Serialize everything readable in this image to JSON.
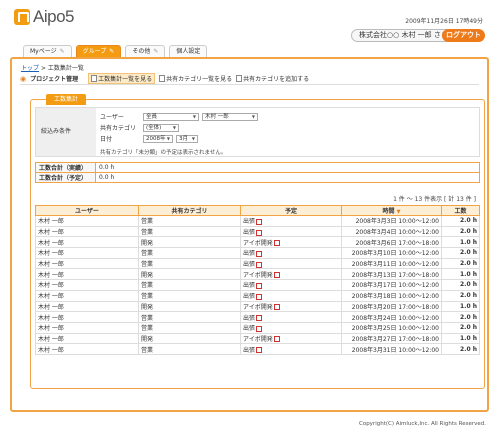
{
  "app": {
    "name": "Aipo5"
  },
  "header": {
    "datetime": "2009年11月26日 17時49分",
    "user": "株式会社○○ 木村 一郎 さま",
    "logout": "ログアウト"
  },
  "tabs": [
    "Myページ",
    "グループ",
    "その他",
    "個人設定"
  ],
  "breadcrumb": {
    "top": "トップ",
    "sep": " > ",
    "current": "工数集計一覧"
  },
  "subnav": {
    "title": "プロジェクト管理",
    "links": [
      "工数集計一覧を見る",
      "共有カテゴリ一覧を見る",
      "共有カテゴリを追加する"
    ]
  },
  "panel_tab": "工数集計",
  "filter": {
    "label": "絞込み条件",
    "user_label": "ユーザー",
    "group_value": "全員",
    "user_value": "木村 一郎",
    "category_label": "共有カテゴリ",
    "category_value": "(全体)",
    "date_label": "日付",
    "year_value": "2008年",
    "month_value": "3月",
    "note": "共有カテゴリ「未分類」の予定は表示されません。"
  },
  "summary": [
    {
      "label": "工数合計（実績）",
      "value": "0.0 h"
    },
    {
      "label": "工数合計（予定）",
      "value": "0.0 h"
    }
  ],
  "count": "1 件 〜 13 件表示 [ 計 13 件 ]",
  "columns": [
    "ユーザー",
    "共有カテゴリ",
    "予定",
    "時間",
    "工数"
  ],
  "rows": [
    [
      "木村 一郎",
      "営業",
      "出張",
      "2008年3月3日 10:00〜12:00",
      "2.0 h"
    ],
    [
      "木村 一郎",
      "営業",
      "出張",
      "2008年3月4日 10:00〜12:00",
      "2.0 h"
    ],
    [
      "木村 一郎",
      "開発",
      "アイボ開発",
      "2008年3月6日 17:00〜18:00",
      "1.0 h"
    ],
    [
      "木村 一郎",
      "営業",
      "出張",
      "2008年3月10日 10:00〜12:00",
      "2.0 h"
    ],
    [
      "木村 一郎",
      "営業",
      "出張",
      "2008年3月11日 10:00〜12:00",
      "2.0 h"
    ],
    [
      "木村 一郎",
      "開発",
      "アイボ開発",
      "2008年3月13日 17:00〜18:00",
      "1.0 h"
    ],
    [
      "木村 一郎",
      "営業",
      "出張",
      "2008年3月17日 10:00〜12:00",
      "2.0 h"
    ],
    [
      "木村 一郎",
      "営業",
      "出張",
      "2008年3月18日 10:00〜12:00",
      "2.0 h"
    ],
    [
      "木村 一郎",
      "開発",
      "アイボ開発",
      "2008年3月20日 17:00〜18:00",
      "1.0 h"
    ],
    [
      "木村 一郎",
      "営業",
      "出張",
      "2008年3月24日 10:00〜12:00",
      "2.0 h"
    ],
    [
      "木村 一郎",
      "営業",
      "出張",
      "2008年3月25日 10:00〜12:00",
      "2.0 h"
    ],
    [
      "木村 一郎",
      "開発",
      "アイボ開発",
      "2008年3月27日 17:00〜18:00",
      "1.0 h"
    ],
    [
      "木村 一郎",
      "営業",
      "出張",
      "2008年3月31日 10:00〜12:00",
      "2.0 h"
    ]
  ],
  "footer": "Copyright(C) Aimluck,Inc. All Rights Reserved.",
  "colors": {
    "accent": "#f39c12",
    "logout": "#ee7a1a",
    "border": "#f2a444"
  }
}
